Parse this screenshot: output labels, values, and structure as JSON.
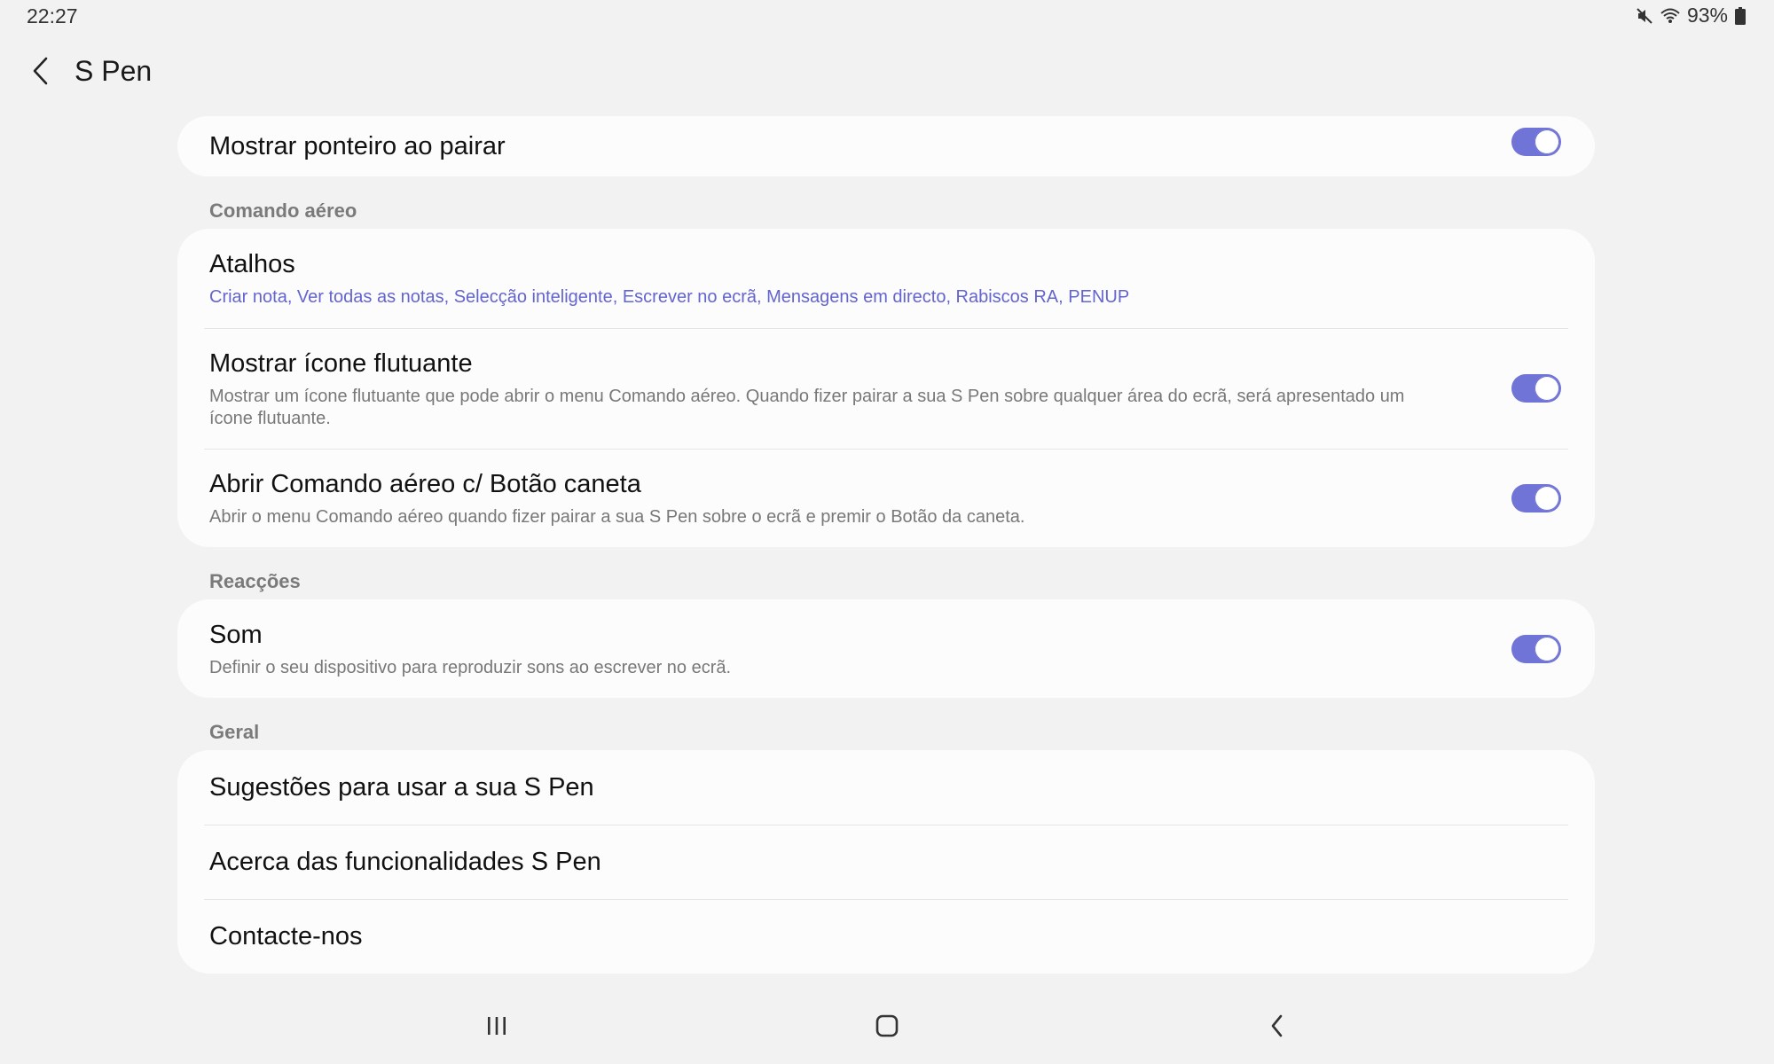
{
  "status_bar": {
    "time": "22:27",
    "battery_percent": "93%",
    "icons": [
      "mute-icon",
      "wifi-icon",
      "battery-icon"
    ]
  },
  "header": {
    "title": "S Pen",
    "back_icon": "back-arrow-icon"
  },
  "top_card": {
    "hover_pointer": {
      "title": "Mostrar ponteiro ao pairar",
      "enabled": true
    }
  },
  "air_command": {
    "header": "Comando aéreo",
    "shortcuts": {
      "title": "Atalhos",
      "summary": "Criar nota, Ver todas as notas, Selecção inteligente, Escrever no ecrã, Mensagens em directo, Rabiscos RA, PENUP"
    },
    "floating_icon": {
      "title": "Mostrar ícone flutuante",
      "summary": "Mostrar um ícone flutuante que pode abrir o menu Comando aéreo. Quando fizer pairar a sua S Pen sobre qualquer área do ecrã, será apresentado um ícone flutuante.",
      "enabled": true
    },
    "pen_button": {
      "title": "Abrir Comando aéreo c/ Botão caneta",
      "summary": "Abrir o menu Comando aéreo quando fizer pairar a sua S Pen sobre o ecrã e premir o Botão da caneta.",
      "enabled": true
    }
  },
  "feedback": {
    "header": "Reacções",
    "sound": {
      "title": "Som",
      "summary": "Definir o seu dispositivo para reproduzir sons ao escrever no ecrã.",
      "enabled": true
    }
  },
  "general": {
    "header": "Geral",
    "tips": "Sugestões para usar a sua S Pen",
    "about": "Acerca das funcionalidades S Pen",
    "contact": "Contacte-nos"
  },
  "nav_bar": {
    "icons": [
      "recent-apps-icon",
      "home-icon",
      "back-icon"
    ]
  },
  "colors": {
    "background": "#f2f2f2",
    "card": "#fcfcfc",
    "accent": "#7074d6",
    "summary_accent": "#6464cf"
  }
}
